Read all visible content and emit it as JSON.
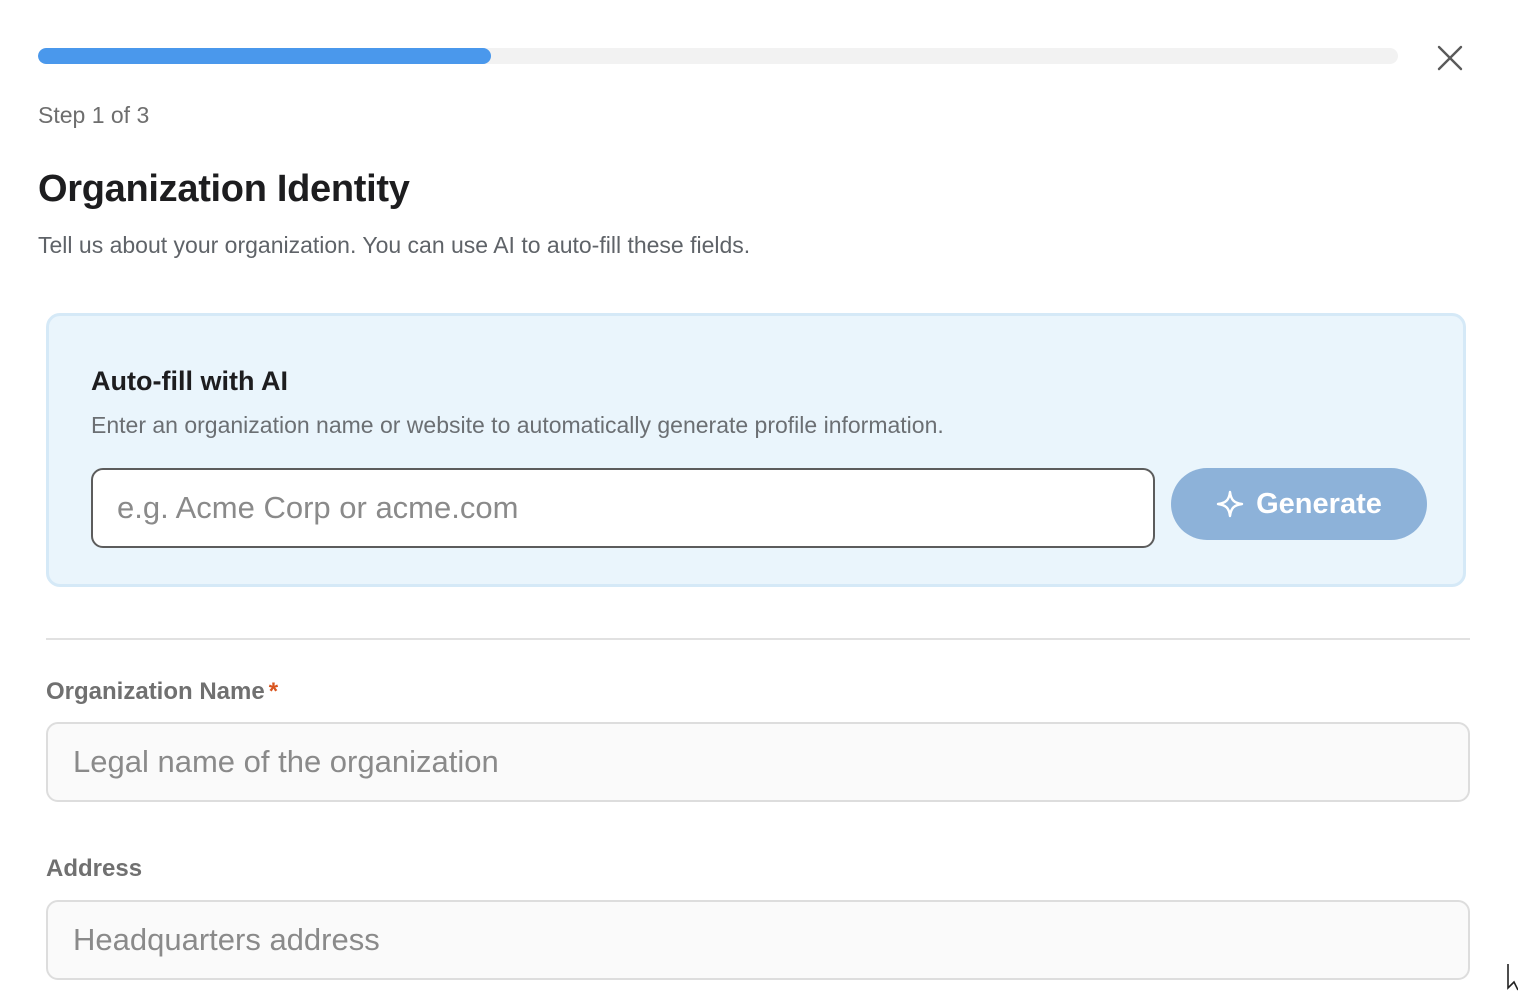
{
  "progress": {
    "fraction": 0.333,
    "color": "#4a98ec",
    "track_color": "#f2f2f2"
  },
  "close_icon": "close-icon",
  "step_text": "Step 1 of 3",
  "title": "Organization Identity",
  "subtitle": "Tell us about your organization. You can use AI to auto-fill these fields.",
  "ai_autofill": {
    "title": "Auto-fill with AI",
    "description": "Enter an organization name or website to automatically generate profile information.",
    "input": {
      "value": "",
      "placeholder": "e.g. Acme Corp or acme.com"
    },
    "generate_button": {
      "label": "Generate",
      "icon": "sparkle-icon",
      "color": "#8db2d9"
    },
    "background_color": "#eaf5fc"
  },
  "fields": {
    "organization_name": {
      "label": "Organization Name",
      "required_marker": "*",
      "placeholder": "Legal name of the organization",
      "value": ""
    },
    "address": {
      "label": "Address",
      "placeholder": "Headquarters address",
      "value": ""
    }
  },
  "colors": {
    "required": "#d9541e"
  }
}
